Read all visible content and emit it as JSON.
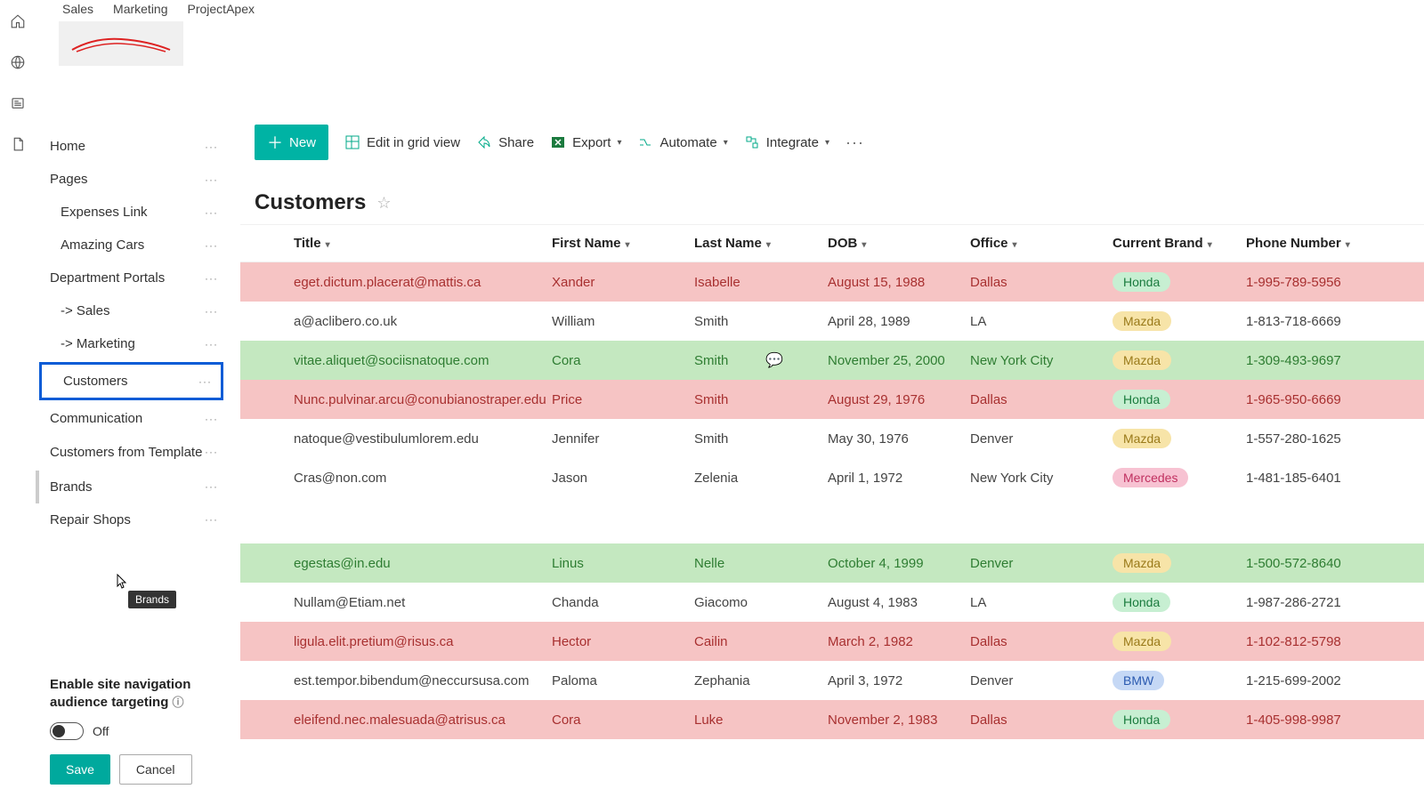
{
  "topTabs": [
    "Sales",
    "Marketing",
    "ProjectApex"
  ],
  "sidebar": {
    "items": [
      {
        "label": "Home",
        "sub": false
      },
      {
        "label": "Pages",
        "sub": false
      },
      {
        "label": "Expenses Link",
        "sub": true
      },
      {
        "label": "Amazing Cars",
        "sub": true
      },
      {
        "label": "Department Portals",
        "sub": false
      },
      {
        "label": "-> Sales",
        "sub": true
      },
      {
        "label": "-> Marketing",
        "sub": true
      },
      {
        "label": "Customers",
        "sub": true,
        "selected": true
      },
      {
        "label": "Communication",
        "sub": false
      },
      {
        "label": "Customers from Template",
        "sub": false,
        "multi": true
      },
      {
        "label": "Brands",
        "sub": false,
        "hover": true
      },
      {
        "label": "Repair Shops",
        "sub": false
      }
    ],
    "tooltip": "Brands"
  },
  "settings": {
    "title": "Enable site navigation audience targeting",
    "toggleLabel": "Off",
    "save": "Save",
    "cancel": "Cancel"
  },
  "cmdbar": {
    "new": "New",
    "edit": "Edit in grid view",
    "share": "Share",
    "export": "Export",
    "automate": "Automate",
    "integrate": "Integrate"
  },
  "list": {
    "title": "Customers",
    "columns": [
      "Title",
      "First Name",
      "Last Name",
      "DOB",
      "Office",
      "Current Brand",
      "Phone Number"
    ],
    "rowsTop": [
      {
        "style": "red",
        "title": "eget.dictum.placerat@mattis.ca",
        "fn": "Xander",
        "ln": "Isabelle",
        "dob": "August 15, 1988",
        "off": "Dallas",
        "brand": "Honda",
        "btag": "honda",
        "phone": "1-995-789-5956"
      },
      {
        "style": "plain",
        "title": "a@aclibero.co.uk",
        "fn": "William",
        "ln": "Smith",
        "dob": "April 28, 1989",
        "off": "LA",
        "brand": "Mazda",
        "btag": "mazda",
        "phone": "1-813-718-6669"
      },
      {
        "style": "green",
        "title": "vitae.aliquet@sociisnatoque.com",
        "fn": "Cora",
        "ln": "Smith",
        "dob": "November 25, 2000",
        "off": "New York City",
        "brand": "Mazda",
        "btag": "mazda",
        "phone": "1-309-493-9697",
        "comment": true
      },
      {
        "style": "red",
        "title": "Nunc.pulvinar.arcu@conubianostraper.edu",
        "fn": "Price",
        "ln": "Smith",
        "dob": "August 29, 1976",
        "off": "Dallas",
        "brand": "Honda",
        "btag": "honda",
        "phone": "1-965-950-6669"
      },
      {
        "style": "plain",
        "title": "natoque@vestibulumlorem.edu",
        "fn": "Jennifer",
        "ln": "Smith",
        "dob": "May 30, 1976",
        "off": "Denver",
        "brand": "Mazda",
        "btag": "mazda",
        "phone": "1-557-280-1625"
      },
      {
        "style": "plain",
        "title": "Cras@non.com",
        "fn": "Jason",
        "ln": "Zelenia",
        "dob": "April 1, 1972",
        "off": "New York City",
        "brand": "Mercedes",
        "btag": "mercedes",
        "phone": "1-481-185-6401"
      }
    ],
    "rowsBottom": [
      {
        "style": "green",
        "title": "egestas@in.edu",
        "fn": "Linus",
        "ln": "Nelle",
        "dob": "October 4, 1999",
        "off": "Denver",
        "brand": "Mazda",
        "btag": "mazda",
        "phone": "1-500-572-8640"
      },
      {
        "style": "plain",
        "title": "Nullam@Etiam.net",
        "fn": "Chanda",
        "ln": "Giacomo",
        "dob": "August 4, 1983",
        "off": "LA",
        "brand": "Honda",
        "btag": "honda",
        "phone": "1-987-286-2721"
      },
      {
        "style": "red",
        "title": "ligula.elit.pretium@risus.ca",
        "fn": "Hector",
        "ln": "Cailin",
        "dob": "March 2, 1982",
        "off": "Dallas",
        "brand": "Mazda",
        "btag": "mazda",
        "phone": "1-102-812-5798"
      },
      {
        "style": "plain",
        "title": "est.tempor.bibendum@neccursusa.com",
        "fn": "Paloma",
        "ln": "Zephania",
        "dob": "April 3, 1972",
        "off": "Denver",
        "brand": "BMW",
        "btag": "bmw",
        "phone": "1-215-699-2002"
      },
      {
        "style": "red",
        "title": "eleifend.nec.malesuada@atrisus.ca",
        "fn": "Cora",
        "ln": "Luke",
        "dob": "November 2, 1983",
        "off": "Dallas",
        "brand": "Honda",
        "btag": "honda",
        "phone": "1-405-998-9987"
      }
    ]
  }
}
